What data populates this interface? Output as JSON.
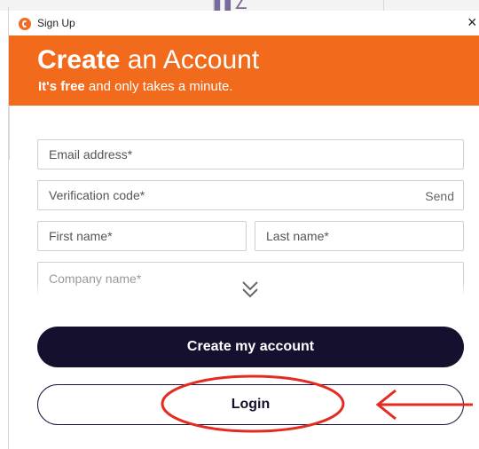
{
  "window": {
    "title": "Sign Up",
    "close_glyph": "×",
    "app_icon": "app-logo-icon"
  },
  "banner": {
    "heading_bold": "Create",
    "heading_rest": " an Account",
    "sub_bold": "It's free",
    "sub_rest": " and only takes a minute."
  },
  "form": {
    "email_placeholder": "Email address*",
    "code_placeholder": "Verification code*",
    "send_label": "Send",
    "first_name_placeholder": "First name*",
    "last_name_placeholder": "Last name*",
    "company_placeholder": "Company name*",
    "scroll_icon": "double-chevron-down-icon"
  },
  "buttons": {
    "create_label": "Create my account",
    "login_label": "Login"
  },
  "colors": {
    "brand_orange": "#f26a1b",
    "primary_dark": "#15102e",
    "annotation_red": "#e32b22"
  }
}
